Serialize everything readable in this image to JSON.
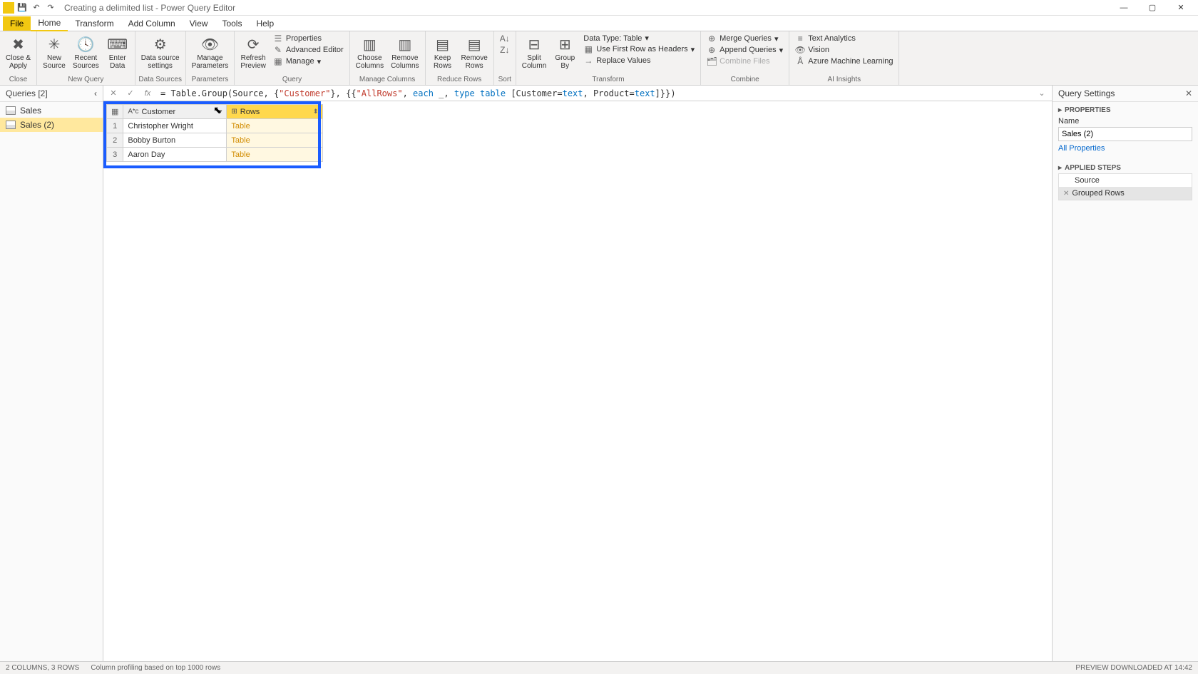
{
  "title": "Creating a delimited list - Power Query Editor",
  "menu": {
    "file": "File",
    "home": "Home",
    "transform": "Transform",
    "addcol": "Add Column",
    "view": "View",
    "tools": "Tools",
    "help": "Help"
  },
  "ribbon": {
    "close": {
      "closeApply": "Close &\nApply",
      "group": "Close"
    },
    "newquery": {
      "newSource": "New\nSource",
      "recentSources": "Recent\nSources",
      "enterData": "Enter\nData",
      "group": "New Query"
    },
    "datasources": {
      "settings": "Data source\nsettings",
      "group": "Data Sources"
    },
    "parameters": {
      "manage": "Manage\nParameters",
      "group": "Parameters"
    },
    "query": {
      "refresh": "Refresh\nPreview",
      "properties": "Properties",
      "advanced": "Advanced Editor",
      "manage": "Manage",
      "group": "Query"
    },
    "managecols": {
      "choose": "Choose\nColumns",
      "remove": "Remove\nColumns",
      "group": "Manage Columns"
    },
    "reducerows": {
      "keep": "Keep\nRows",
      "remove": "Remove\nRows",
      "group": "Reduce Rows"
    },
    "sort": {
      "group": "Sort"
    },
    "transform": {
      "split": "Split\nColumn",
      "groupBy": "Group\nBy",
      "dataType": "Data Type: Table",
      "firstRow": "Use First Row as Headers",
      "replace": "Replace Values",
      "group": "Transform"
    },
    "combine": {
      "merge": "Merge Queries",
      "append": "Append Queries",
      "combineFiles": "Combine Files",
      "group": "Combine"
    },
    "ai": {
      "textAnalytics": "Text Analytics",
      "vision": "Vision",
      "azureML": "Azure Machine Learning",
      "group": "AI Insights"
    }
  },
  "queriesPane": {
    "title": "Queries [2]",
    "items": [
      {
        "name": "Sales"
      },
      {
        "name": "Sales (2)"
      }
    ]
  },
  "formula": {
    "prefix": "= Table.Group(Source, {",
    "str1": "\"Customer\"",
    "mid1": "}, {{",
    "str2": "\"AllRows\"",
    "mid2": ", ",
    "kw_each": "each",
    "mid3": " _, ",
    "kw_type": "type",
    "mid4": " ",
    "kw_table": "table",
    "mid5": " [Customer=",
    "kw_text1": "text",
    "mid6": ", Product=",
    "kw_text2": "text",
    "suffix": "]}})"
  },
  "grid": {
    "cols": [
      {
        "name": "Customer",
        "typeIcon": "A𝄌c"
      },
      {
        "name": "AllRows",
        "typeIcon": "⊞",
        "displayName": "Rows"
      }
    ],
    "rows": [
      {
        "n": "1",
        "customer": "Christopher Wright",
        "allrows": "Table"
      },
      {
        "n": "2",
        "customer": "Bobby Burton",
        "allrows": "Table"
      },
      {
        "n": "3",
        "customer": "Aaron Day",
        "allrows": "Table"
      }
    ]
  },
  "settings": {
    "title": "Query Settings",
    "propsSection": "PROPERTIES",
    "nameLabel": "Name",
    "nameValue": "Sales (2)",
    "allProps": "All Properties",
    "stepsSection": "APPLIED STEPS",
    "steps": [
      {
        "name": "Source"
      },
      {
        "name": "Grouped Rows"
      }
    ]
  },
  "status": {
    "cols": "2 COLUMNS, 3 ROWS",
    "profiling": "Column profiling based on top 1000 rows",
    "preview": "PREVIEW DOWNLOADED AT 14:42"
  }
}
